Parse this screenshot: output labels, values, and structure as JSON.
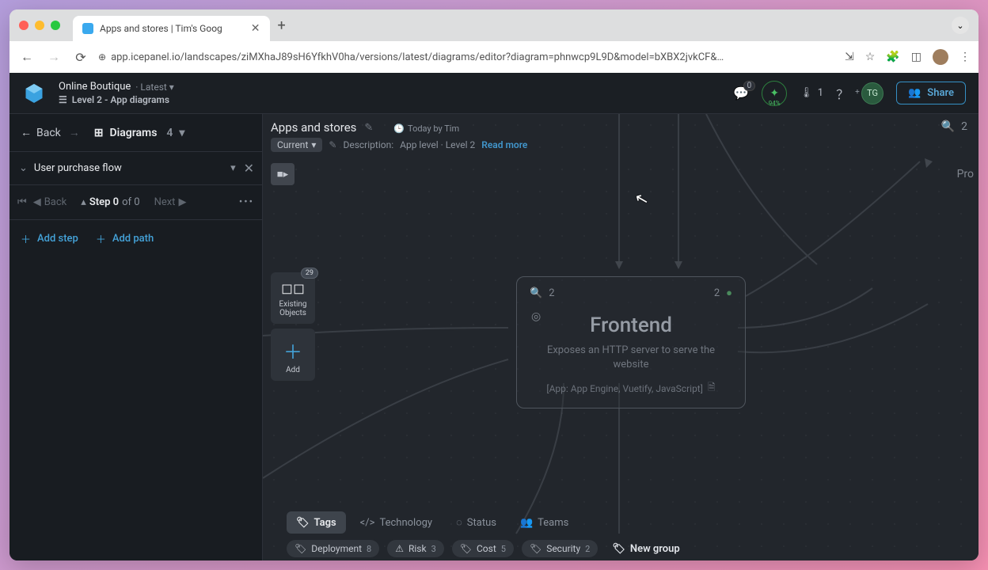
{
  "browser": {
    "tab_title": "Apps and stores | Tim's Goog",
    "url": "app.icepanel.io/landscapes/ziMXhaJ89sH6YfkhV0ha/versions/latest/diagrams/editor?diagram=phnwcp9L9D&model=bXBX2jvkCF&…"
  },
  "header": {
    "project": "Online Boutique",
    "version": "Latest",
    "level_text": "Level 2 - App diagrams",
    "comments_badge": "0",
    "sparkle_pct": "94%",
    "temp_value": "1",
    "user_initials": "TG",
    "share_label": "Share"
  },
  "left_panel": {
    "back_label": "Back",
    "diagrams_label": "Diagrams",
    "diagrams_count": "4",
    "flow_name": "User purchase flow",
    "step_back": "Back",
    "step_text_a": "Step 0",
    "step_text_b": "of 0",
    "step_next": "Next",
    "add_step": "Add step",
    "add_path": "Add path"
  },
  "canvas": {
    "title": "Apps and stores",
    "meta": "Today by Tim",
    "pill": "Current",
    "desc_label": "Description:",
    "desc_text": "App level · Level 2",
    "read_more": "Read more",
    "zoom_count": "2",
    "existing_label": "Existing Objects",
    "existing_badge": "29",
    "add_label": "Add",
    "side_label": "Pro"
  },
  "node": {
    "zoom_badge": "2",
    "status_badge": "2",
    "title": "Frontend",
    "desc": "Exposes an HTTP server to serve the website",
    "tags": "[App: App Engine, Vuetify, JavaScript]"
  },
  "bottom_tabs": {
    "tags": "Tags",
    "technology": "Technology",
    "status": "Status",
    "teams": "Teams"
  },
  "chips": {
    "deployment": {
      "label": "Deployment",
      "count": "8"
    },
    "risk": {
      "label": "Risk",
      "count": "3"
    },
    "cost": {
      "label": "Cost",
      "count": "5"
    },
    "security": {
      "label": "Security",
      "count": "2"
    },
    "new_group": "New group"
  }
}
